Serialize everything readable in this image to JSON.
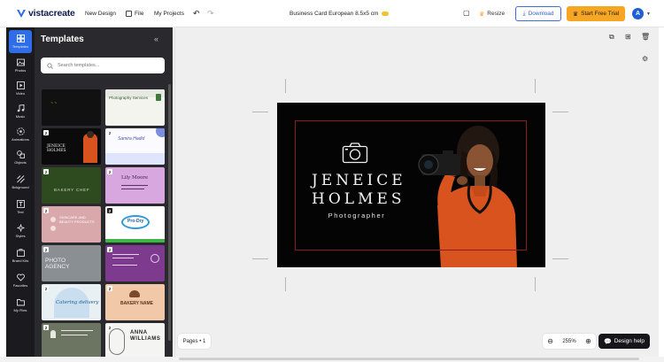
{
  "topbar": {
    "logo_text": "vistacreate",
    "new_design": "New Design",
    "file": "File",
    "my_projects": "My Projects",
    "doc_title": "Business Card European 8.5x5 cm",
    "resize": "Resize",
    "download": "Download",
    "start_trial": "Start Free Trial",
    "avatar_letter": "A"
  },
  "rail": {
    "items": [
      {
        "label": "Templates",
        "icon": "templates-icon"
      },
      {
        "label": "Photos",
        "icon": "photos-icon"
      },
      {
        "label": "Video",
        "icon": "video-icon"
      },
      {
        "label": "Music",
        "icon": "music-icon"
      },
      {
        "label": "Animations",
        "icon": "animations-icon"
      },
      {
        "label": "Objects",
        "icon": "objects-icon"
      },
      {
        "label": "Bckground",
        "icon": "background-icon"
      },
      {
        "label": "Text",
        "icon": "text-icon"
      },
      {
        "label": "Styles",
        "icon": "styles-icon"
      },
      {
        "label": "Brand Kits",
        "icon": "brand-kits-icon"
      },
      {
        "label": "Favorites",
        "icon": "heart-icon"
      },
      {
        "label": "My Files",
        "icon": "folder-icon"
      }
    ]
  },
  "panel": {
    "title": "Templates",
    "search_placeholder": "Search templates..."
  },
  "thumbnails": [
    {
      "badge": "",
      "text": ""
    },
    {
      "badge": "",
      "text": "Photography Services"
    },
    {
      "badge": "2",
      "text": "JENEICE HOLMES"
    },
    {
      "badge": "2",
      "text": "Samira Hadid"
    },
    {
      "badge": "2",
      "text": "BAKERY CHEF"
    },
    {
      "badge": "2",
      "text": "Lily Moore"
    },
    {
      "badge": "2",
      "text": "SKINCARE AND BEAUTY PRODUCTS"
    },
    {
      "badge": "2",
      "text": "Pro-Dry"
    },
    {
      "badge": "2",
      "text": "PHOTO AGENCY"
    },
    {
      "badge": "2",
      "text": ""
    },
    {
      "badge": "2",
      "text": "Catering delivery"
    },
    {
      "badge": "2",
      "text": "BAKERY NAME"
    },
    {
      "badge": "2",
      "text": ""
    },
    {
      "badge": "2",
      "text": "ANNA WILLIAMS"
    }
  ],
  "card": {
    "name_line1": "JENEICE",
    "name_line2": "HOLMES",
    "role": "Photographer"
  },
  "footer": {
    "pages": "Pages • 1",
    "zoom": "255%",
    "help": "Design help"
  },
  "colors": {
    "accent_blue": "#2f6ee8",
    "trial_orange": "#f6a623",
    "rail_bg": "#1b1b1f",
    "panel_bg": "#2a2a2e",
    "card_bg": "#040404",
    "card_frame": "#8c1c1c"
  }
}
